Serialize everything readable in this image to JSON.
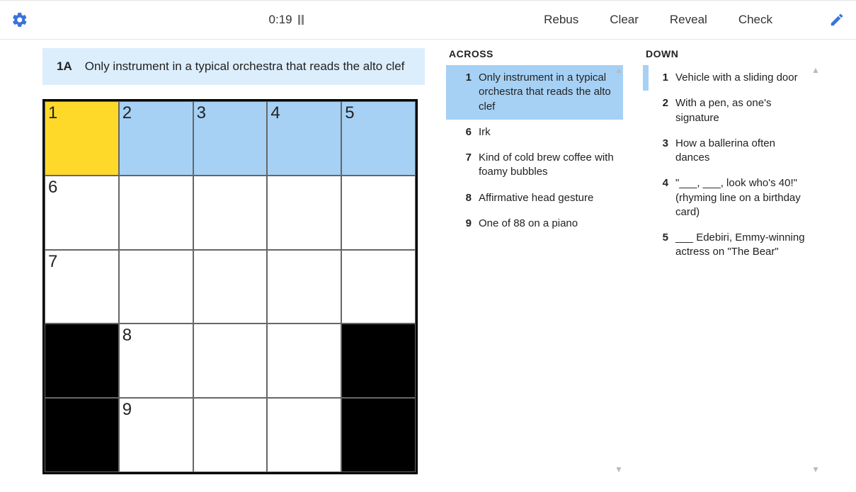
{
  "toolbar": {
    "timer": "0:19",
    "rebus": "Rebus",
    "clear": "Clear",
    "reveal": "Reveal",
    "check": "Check"
  },
  "currentClue": {
    "label": "1A",
    "text": "Only instrument in a typical orchestra that reads the alto clef"
  },
  "grid": {
    "rows": 5,
    "cols": 5,
    "cells": [
      {
        "num": "1",
        "state": "cur"
      },
      {
        "num": "2",
        "state": "hl"
      },
      {
        "num": "3",
        "state": "hl"
      },
      {
        "num": "4",
        "state": "hl"
      },
      {
        "num": "5",
        "state": "hl"
      },
      {
        "num": "6",
        "state": ""
      },
      {
        "num": "",
        "state": ""
      },
      {
        "num": "",
        "state": ""
      },
      {
        "num": "",
        "state": ""
      },
      {
        "num": "",
        "state": ""
      },
      {
        "num": "7",
        "state": ""
      },
      {
        "num": "",
        "state": ""
      },
      {
        "num": "",
        "state": ""
      },
      {
        "num": "",
        "state": ""
      },
      {
        "num": "",
        "state": ""
      },
      {
        "num": "",
        "state": "black"
      },
      {
        "num": "8",
        "state": ""
      },
      {
        "num": "",
        "state": ""
      },
      {
        "num": "",
        "state": ""
      },
      {
        "num": "",
        "state": "black"
      },
      {
        "num": "",
        "state": "black"
      },
      {
        "num": "9",
        "state": ""
      },
      {
        "num": "",
        "state": ""
      },
      {
        "num": "",
        "state": ""
      },
      {
        "num": "",
        "state": "black"
      }
    ]
  },
  "across": {
    "title": "ACROSS",
    "clues": [
      {
        "n": "1",
        "text": "Only instrument in a typical orchestra that reads the alto clef",
        "active": true
      },
      {
        "n": "6",
        "text": "Irk"
      },
      {
        "n": "7",
        "text": "Kind of cold brew coffee with foamy bubbles"
      },
      {
        "n": "8",
        "text": "Affirmative head gesture"
      },
      {
        "n": "9",
        "text": "One of 88 on a piano"
      }
    ]
  },
  "down": {
    "title": "DOWN",
    "clues": [
      {
        "n": "1",
        "text": "Vehicle with a sliding door",
        "related": true
      },
      {
        "n": "2",
        "text": "With a pen, as one's signature"
      },
      {
        "n": "3",
        "text": "How a ballerina often dances"
      },
      {
        "n": "4",
        "text": "\"___, ___, look who's 40!\" (rhyming line on a birthday card)"
      },
      {
        "n": "5",
        "text": "___ Edebiri, Emmy-winning actress on \"The Bear\""
      }
    ]
  }
}
